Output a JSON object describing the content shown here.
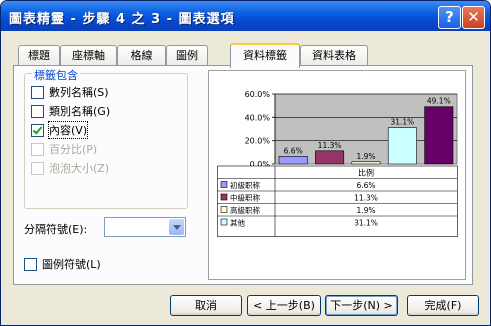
{
  "window": {
    "title": "圖表精靈 - 步驟 4 之 3 - 圖表選項",
    "help_label": "?",
    "close_label": "✕",
    "help_icon": "help-icon",
    "close_icon": "close-icon"
  },
  "tabs": [
    {
      "label": "標題"
    },
    {
      "label": "座標軸"
    },
    {
      "label": "格線"
    },
    {
      "label": "圖例"
    },
    {
      "label": "資料標籤",
      "active": true
    },
    {
      "label": "資料表格"
    }
  ],
  "labels_group": {
    "title": "標籤包含",
    "options": [
      {
        "label": "數列名稱(S)",
        "checked": false,
        "enabled": true
      },
      {
        "label": "類別名稱(G)",
        "checked": false,
        "enabled": true
      },
      {
        "label": "內容(V)",
        "checked": true,
        "enabled": true
      },
      {
        "label": "百分比(P)",
        "checked": false,
        "enabled": false
      },
      {
        "label": "泡泡大小(Z)",
        "checked": false,
        "enabled": false
      }
    ]
  },
  "separator": {
    "label": "分隔符號(E):",
    "value": ""
  },
  "legend_key": {
    "label": "圖例符號(L)",
    "checked": false
  },
  "buttons": {
    "cancel": "取消",
    "back": "< 上一步(B)",
    "next": "下一步(N) >",
    "finish": "完成(F)"
  },
  "colors": {
    "plot_bg": "#c0c0c0",
    "accent_title": "#0a5fe0"
  },
  "chart_data": {
    "type": "bar",
    "categories": [
      "初級职称",
      "中級职称",
      "高級职称",
      "其他"
    ],
    "series": [
      {
        "name": "比例",
        "values": [
          6.6,
          11.3,
          1.9,
          31.1,
          49.1
        ],
        "labels": [
          "6.6%",
          "11.3%",
          "1.9%",
          "31.1%",
          "49.1%"
        ],
        "colors": [
          "#9999ff",
          "#993366",
          "#ffffcc",
          "#ccffff",
          "#660066"
        ]
      }
    ],
    "y_ticks": [
      "60.0%",
      "40.0%",
      "20.0%",
      "0.0%"
    ],
    "ylim": [
      0,
      60
    ],
    "table": {
      "header": "比例",
      "rows": [
        {
          "name": "初級职称",
          "value": "6.6%"
        },
        {
          "name": "中級职称",
          "value": "11.3%"
        },
        {
          "name": "高級职称",
          "value": "1.9%"
        },
        {
          "name": "其他",
          "value": "31.1%"
        }
      ]
    }
  }
}
